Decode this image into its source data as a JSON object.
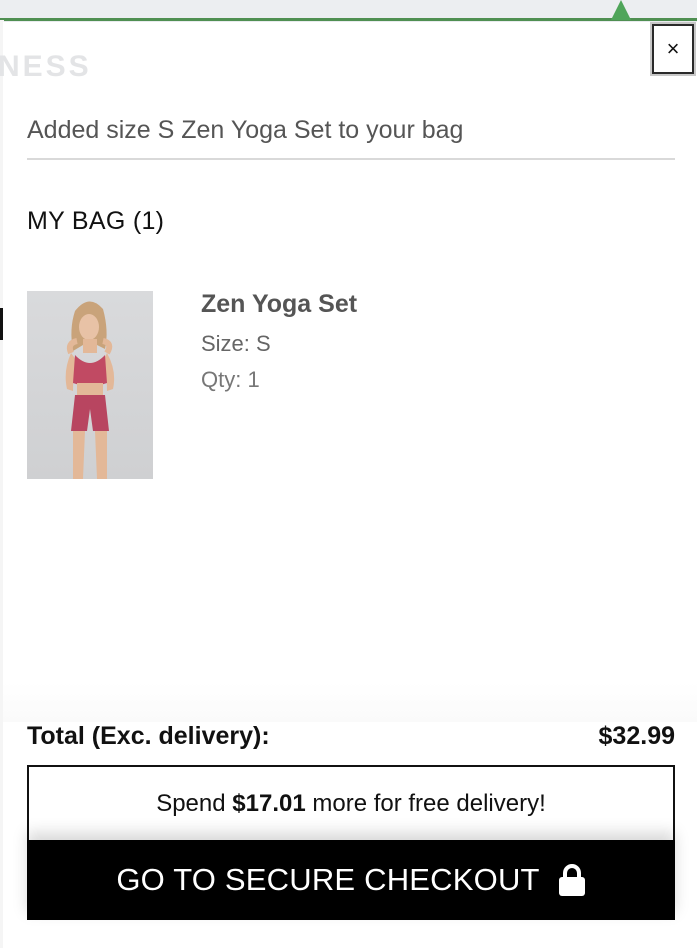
{
  "background": {
    "brand_fragment": "NESS"
  },
  "drawer": {
    "close_label": "×",
    "added_message": "Added size S Zen Yoga Set to your bag",
    "bag_title": "MY BAG (1)"
  },
  "item": {
    "name": "Zen Yoga Set",
    "size": "Size: S",
    "qty": "Qty: 1",
    "image_icon": "product-photo"
  },
  "summary": {
    "total_label": "Total (Exc. delivery):",
    "total_value": "$32.99",
    "free_delivery": {
      "prefix": "Spend ",
      "amount": "$17.01",
      "suffix": " more for free delivery!"
    },
    "checkout_label": "GO TO SECURE CHECKOUT",
    "checkout_icon": "lock-icon"
  },
  "colors": {
    "accent_green": "#4fa55a",
    "button_black": "#000000"
  }
}
